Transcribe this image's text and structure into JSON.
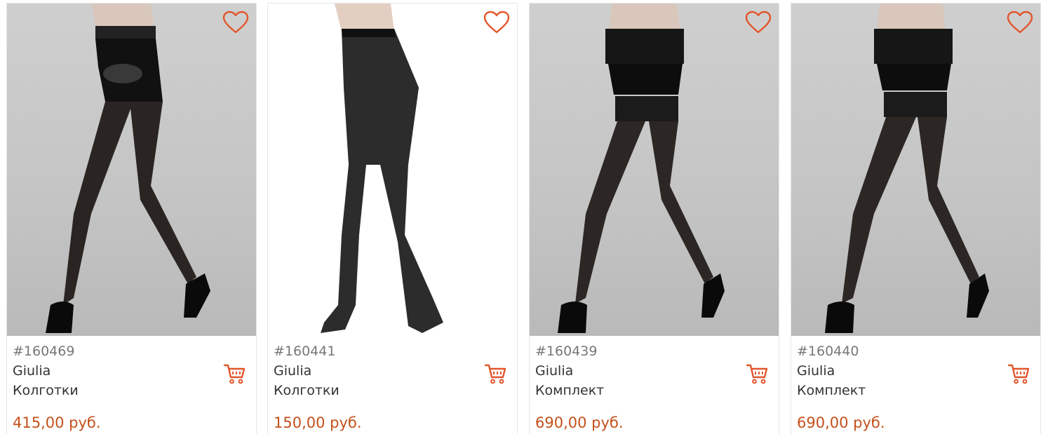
{
  "colors": {
    "accent": "#e2552b",
    "price": "#c5511b",
    "sku": "#777777",
    "text": "#333333"
  },
  "icons": {
    "favorite": "heart-icon",
    "cart": "cart-icon"
  },
  "products": [
    {
      "sku": "#160469",
      "brand": "Giulia",
      "type": "Колготки",
      "price": "415,00 руб."
    },
    {
      "sku": "#160441",
      "brand": "Giulia",
      "type": "Колготки",
      "price": "150,00 руб."
    },
    {
      "sku": "#160439",
      "brand": "Giulia",
      "type": "Комплект",
      "price": "690,00 руб."
    },
    {
      "sku": "#160440",
      "brand": "Giulia",
      "type": "Комплект",
      "price": "690,00 руб."
    }
  ]
}
